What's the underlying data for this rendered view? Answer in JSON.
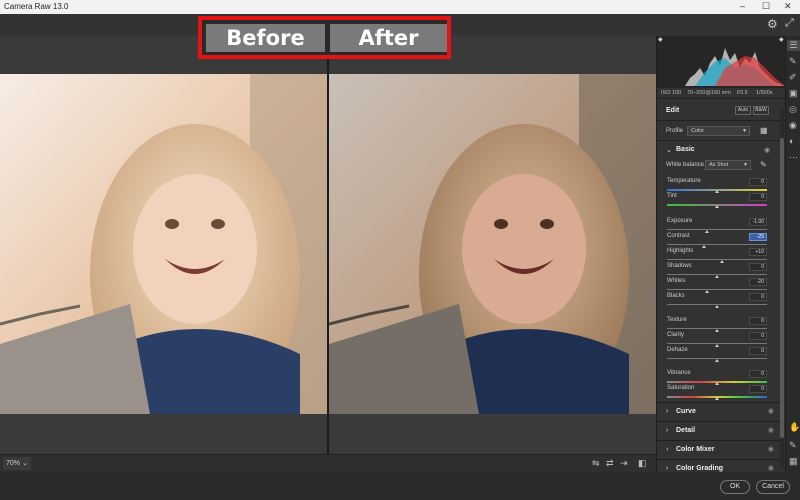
{
  "app": {
    "title": "Camera Raw 13.0"
  },
  "comparison": {
    "before_label": "Before",
    "after_label": "After"
  },
  "view": {
    "zoom": "70%"
  },
  "footer": {
    "ok_label": "OK",
    "cancel_label": "Cancel"
  },
  "exif": {
    "iso": "ISO 100",
    "lens": "70–200@160 mm",
    "aperture": "f/3.5",
    "shutter": "1/500s"
  },
  "edit": {
    "title": "Edit",
    "auto_label": "Auto",
    "bw_label": "B&W",
    "profile_label": "Profile",
    "profile_value": "Color",
    "basic_title": "Basic",
    "white_balance_label": "White balance",
    "white_balance_value": "As Shot",
    "sliders": [
      {
        "label": "Temperature",
        "value": "0",
        "pos": 0.5
      },
      {
        "label": "Tint",
        "value": "0",
        "pos": 0.5
      },
      {
        "label": "Exposure",
        "value": "-1.00",
        "pos": 0.4
      },
      {
        "label": "Contrast",
        "value": "-25",
        "pos": 0.37
      },
      {
        "label": "Highlights",
        "value": "+10",
        "pos": 0.55
      },
      {
        "label": "Shadows",
        "value": "0",
        "pos": 0.5
      },
      {
        "label": "Whites",
        "value": "-20",
        "pos": 0.4
      },
      {
        "label": "Blacks",
        "value": "0",
        "pos": 0.5
      },
      {
        "label": "Texture",
        "value": "0",
        "pos": 0.5
      },
      {
        "label": "Clarity",
        "value": "0",
        "pos": 0.5
      },
      {
        "label": "Dehaze",
        "value": "0",
        "pos": 0.5
      },
      {
        "label": "Vibrance",
        "value": "0",
        "pos": 0.5
      },
      {
        "label": "Saturation",
        "value": "0",
        "pos": 0.5
      }
    ],
    "sections": [
      "Curve",
      "Detail",
      "Color Mixer",
      "Color Grading"
    ]
  },
  "colors": {
    "highlight_red": "#e21414",
    "panel_bg": "#323232",
    "selected_value": "#3b5fa8"
  }
}
